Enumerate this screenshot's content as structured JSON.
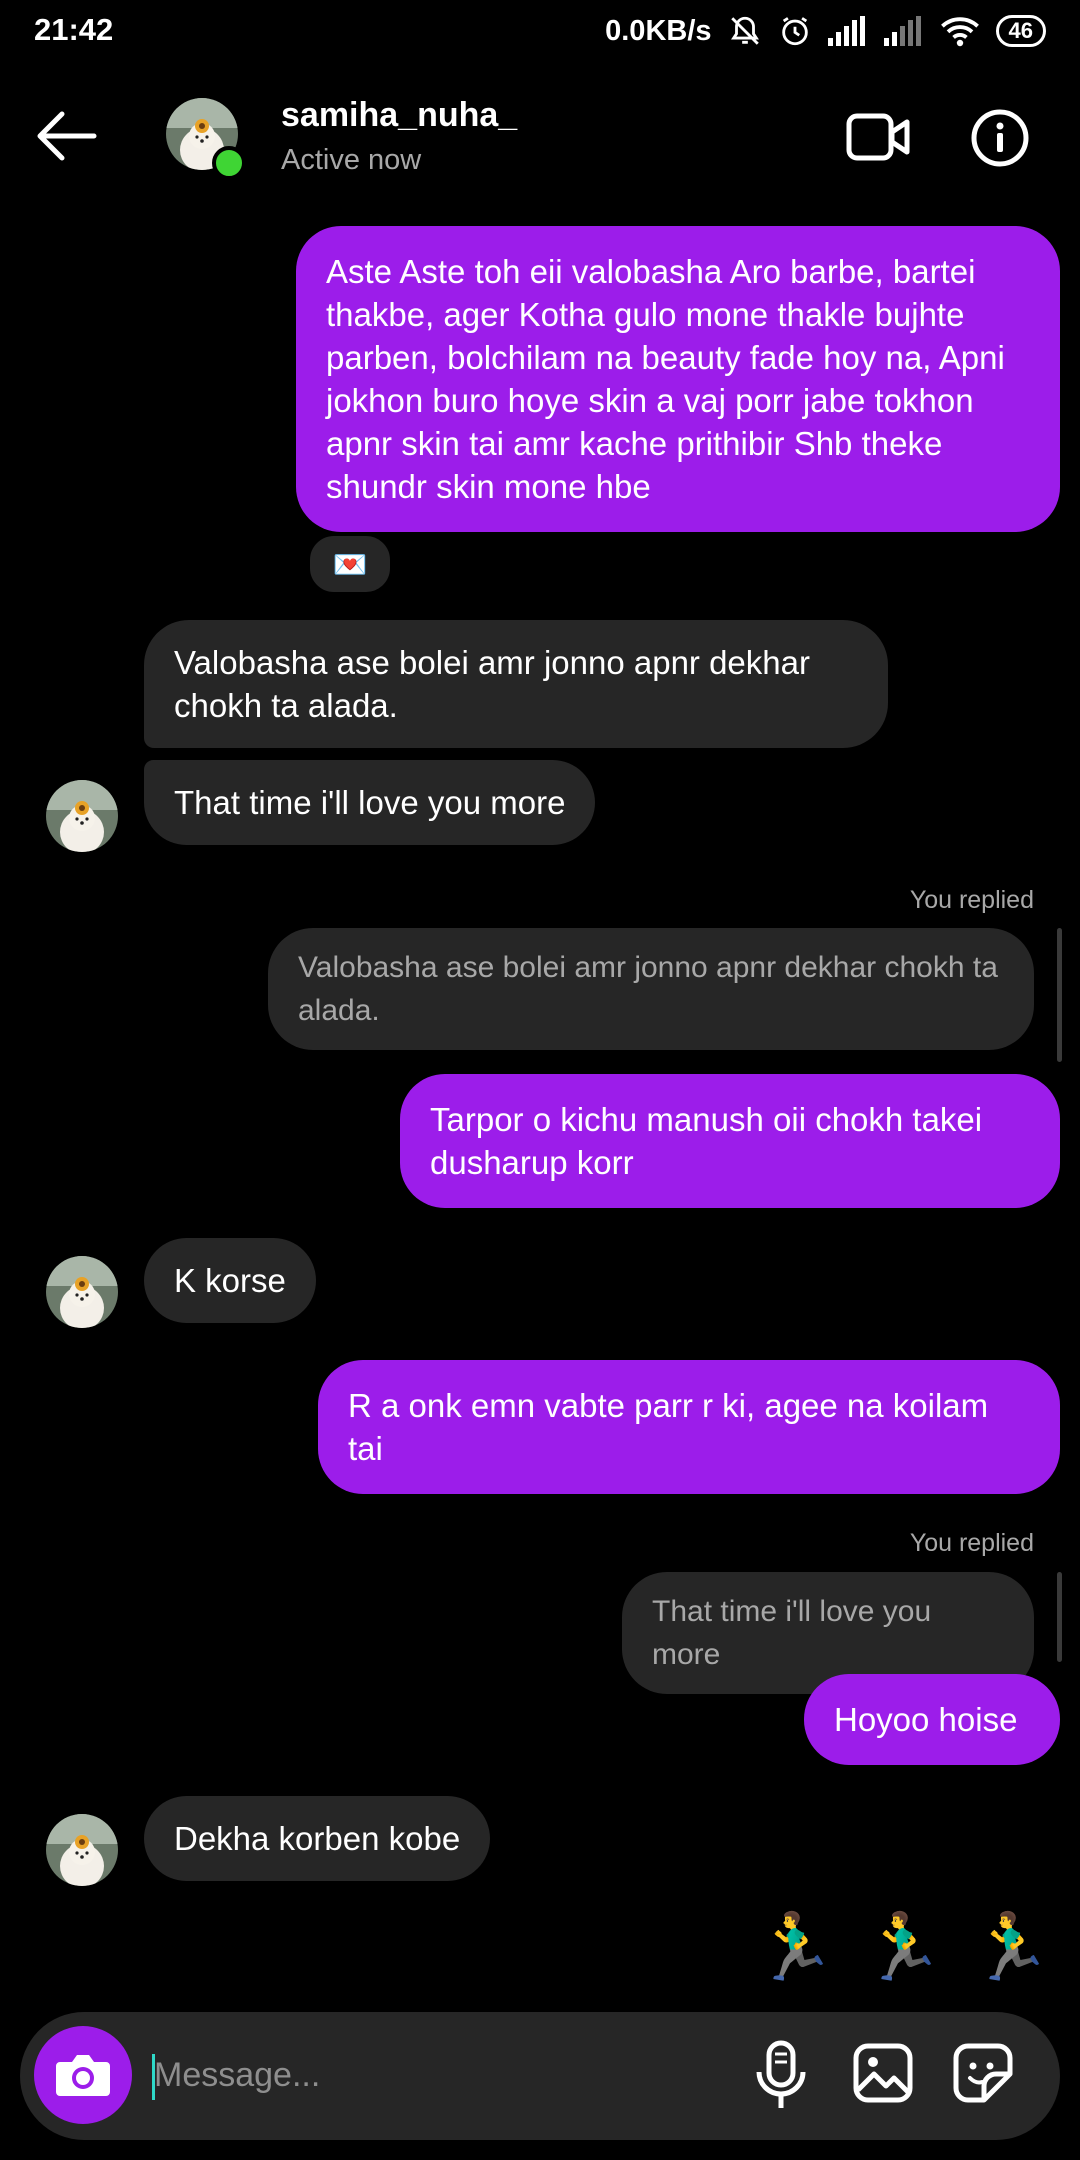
{
  "status_bar": {
    "time": "21:42",
    "net_speed": "0.0KB/s",
    "battery": "46"
  },
  "header": {
    "username": "samiha_nuha_",
    "status": "Active now"
  },
  "messages": {
    "m1": "Aste Aste toh eii valobasha Aro barbe, bartei thakbe, ager Kotha gulo mone thakle bujhte parben, bolchilam na beauty fade hoy na, Apni jokhon buro hoye skin a vaj porr jabe tokhon apnr skin tai amr kache prithibir Shb theke shundr skin mone hbe",
    "m1_reaction": "💌",
    "m2": "Valobasha ase bolei amr jonno apnr dekhar chokh ta alada.",
    "m3": "That time i'll love you more",
    "reply1_label": "You replied",
    "reply1_quote": "Valobasha ase bolei amr jonno apnr dekhar chokh ta alada.",
    "m4": "Tarpor o kichu manush oii chokh takei dusharup korr",
    "m5": "K korse",
    "m6": "R a onk emn vabte parr r ki, agee na koilam tai",
    "reply2_label": "You replied",
    "reply2_quote": "That time i'll love you more",
    "m7": "Hoyoo hoise",
    "m8": "Dekha korben kobe",
    "m9": [
      "🏃‍♂️",
      "🏃‍♂️",
      "🏃‍♂️"
    ]
  },
  "composer": {
    "placeholder": "Message..."
  },
  "colors": {
    "outgoing_bubble": "#9c1dea",
    "incoming_bubble": "#262626",
    "online": "#3fd534"
  },
  "icons": [
    "back-arrow-icon",
    "video-call-icon",
    "info-icon",
    "camera-icon",
    "microphone-icon",
    "gallery-icon",
    "sticker-icon",
    "muted-bell-icon",
    "alarm-icon",
    "signal-icon",
    "wifi-icon"
  ]
}
